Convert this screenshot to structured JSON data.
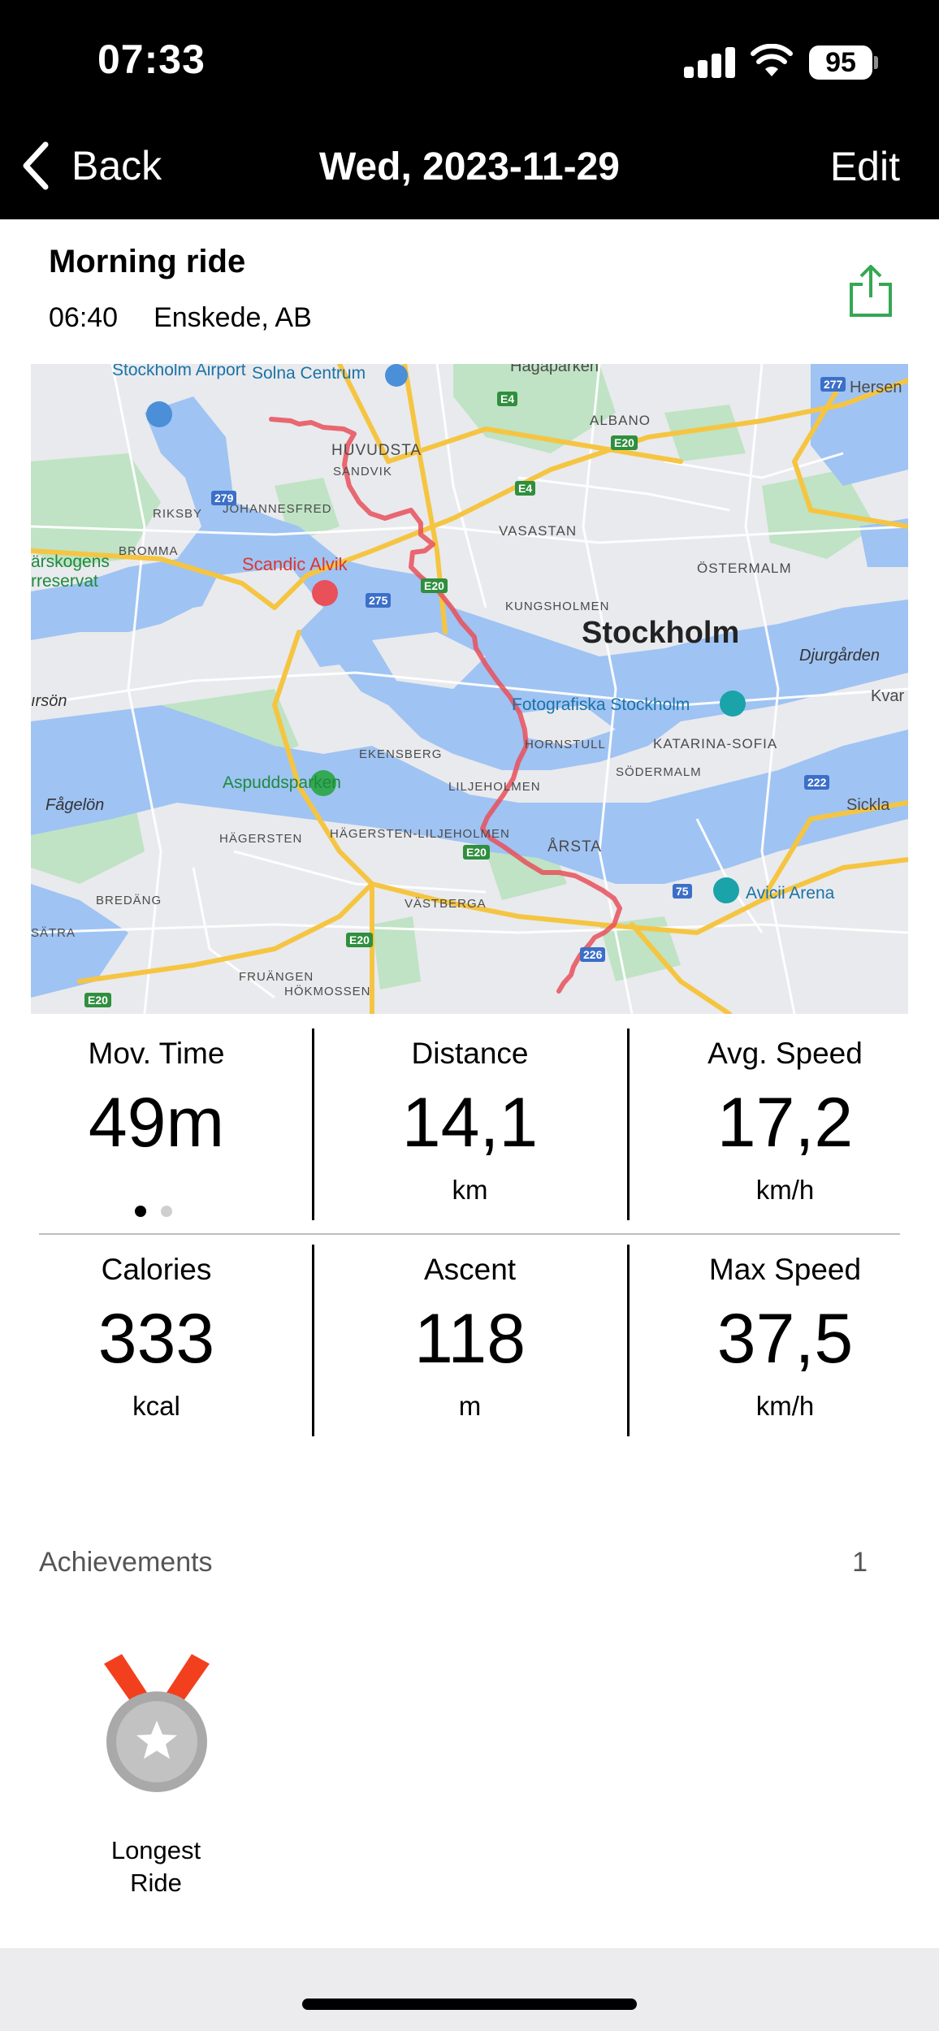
{
  "status_bar": {
    "time": "07:33",
    "battery": "95"
  },
  "nav": {
    "back_label": "Back",
    "title": "Wed, 2023-11-29",
    "edit_label": "Edit"
  },
  "ride": {
    "name": "Morning ride",
    "start_time": "06:40",
    "location": "Enskede, AB"
  },
  "map": {
    "labels": {
      "airport": "Stockholm Airport",
      "solna": "Solna Centrum",
      "hagaparken": "Hagaparken",
      "hersen": "Hersen",
      "albano": "ALBANO",
      "huvudsta": "HUVUDSTA",
      "sandvik": "SANDVIK",
      "riksby": "RIKSBY",
      "johannesfred": "JOHANNESFRED",
      "bromma": "BROMMA",
      "vasastan": "VASASTAN",
      "ostermalm": "ÖSTERMALM",
      "reserve": "ärskogens\nrreservat",
      "scandic": "Scandic Alvik",
      "kungsholmen": "KUNGSHOLMEN",
      "stockholm": "Stockholm",
      "djurgarden": "Djurgården",
      "orson": "ırsön",
      "fotografiska": "Fotografiska Stockholm",
      "kvar": "Kvar",
      "hornstull": "HORNSTULL",
      "katarina": "KATARINA-SOFIA",
      "sodermalm": "SÖDERMALM",
      "ekensberg": "EKENSBERG",
      "aspudd": "Aspuddsparken",
      "liljeholmen": "LILJEHOLMEN",
      "fagelon": "Fågelön",
      "sickla": "Sickla",
      "hagersten": "HÄGERSTEN",
      "hagersten_lilj": "HÄGERSTEN-LILJEHOLMEN",
      "arsta": "ÅRSTA",
      "avicii": "Avicii Arena",
      "bredang": "BREDÄNG",
      "vastberga": "VÄSTBERGA",
      "satra": "SÄTRA",
      "fruangen": "FRUÄNGEN",
      "hokmossen": "HÖKMOSSEN"
    },
    "shields": {
      "e4_a": "E4",
      "e4_b": "E4",
      "e20_a": "E20",
      "e20_b": "E20",
      "e20_c": "E20",
      "e20_d": "E20",
      "e20_e": "E20",
      "r277": "277",
      "r279": "279",
      "r275": "275",
      "r222": "222",
      "r75": "75",
      "r226": "226"
    }
  },
  "stats": {
    "moving_time": {
      "label": "Mov. Time",
      "value": "49m"
    },
    "distance": {
      "label": "Distance",
      "value": "14,1",
      "unit": "km"
    },
    "avg_speed": {
      "label": "Avg. Speed",
      "value": "17,2",
      "unit": "km/h"
    },
    "calories": {
      "label": "Calories",
      "value": "333",
      "unit": "kcal"
    },
    "ascent": {
      "label": "Ascent",
      "value": "118",
      "unit": "m"
    },
    "max_speed": {
      "label": "Max Speed",
      "value": "37,5",
      "unit": "km/h"
    }
  },
  "page_dots": {
    "count": 2,
    "active": 0
  },
  "achievements": {
    "title": "Achievements",
    "count": "1",
    "items": [
      {
        "label": "Longest\nRide",
        "icon": "medal-icon"
      }
    ]
  },
  "colors": {
    "accent_green": "#34a853",
    "route": "#e8505a",
    "medal_ribbon": "#f2401f",
    "medal_silver": "#a9a9a9"
  }
}
